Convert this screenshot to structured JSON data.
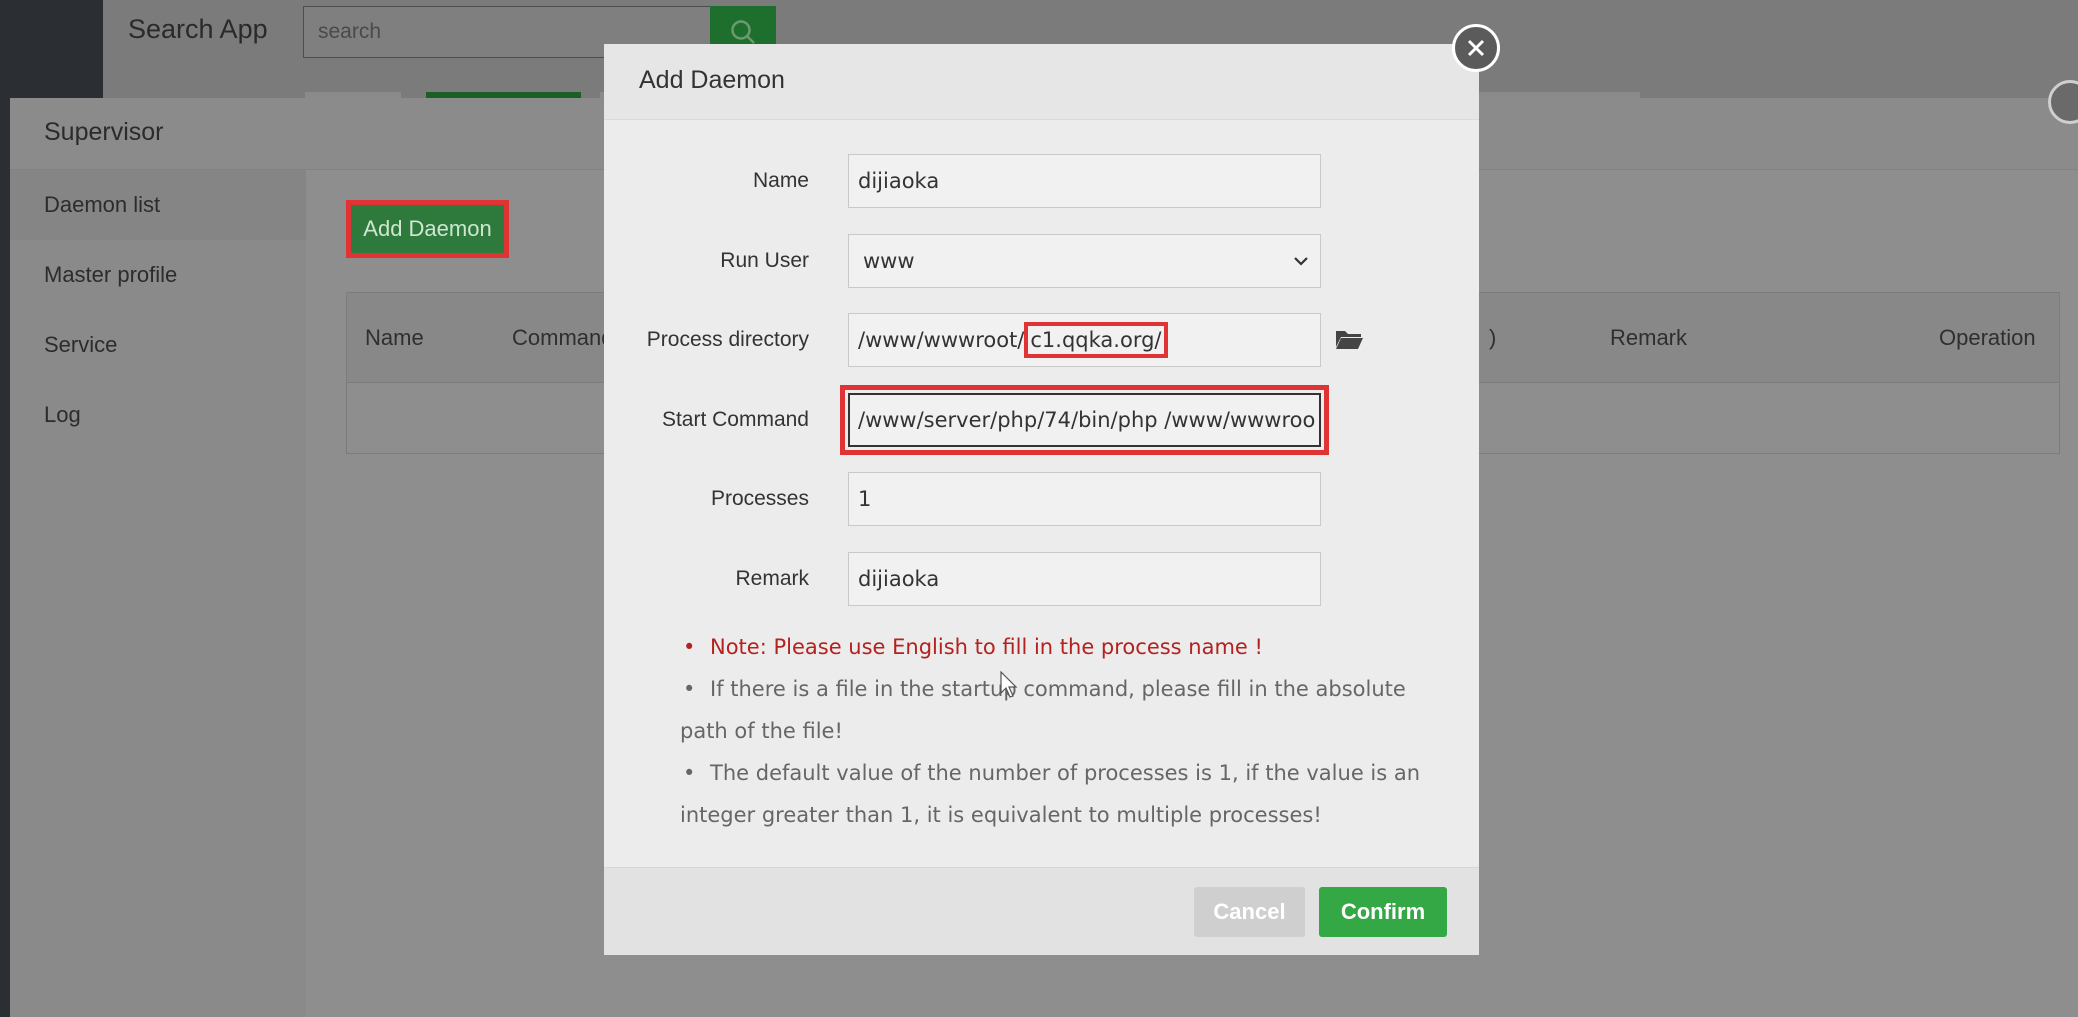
{
  "topbar": {
    "app_title": "Search App",
    "search_placeholder": "search"
  },
  "supervisor": {
    "title": "Supervisor",
    "sidebar": [
      {
        "label": "Daemon list"
      },
      {
        "label": "Master profile"
      },
      {
        "label": "Service"
      },
      {
        "label": "Log"
      }
    ],
    "add_button": "Add Daemon",
    "table_headers": [
      "Name",
      "Command",
      ")",
      "Remark",
      "Operation"
    ]
  },
  "modal": {
    "title": "Add Daemon",
    "fields": {
      "name": {
        "label": "Name",
        "value": "dijiaoka"
      },
      "run_user": {
        "label": "Run User",
        "value": "www"
      },
      "process_directory": {
        "label": "Process directory",
        "value_prefix": "/www/wwwroot/",
        "value_highlight": "c1.qqka.org/"
      },
      "start_command": {
        "label": "Start Command",
        "value": "/www/server/php/74/bin/php /www/wwwroo"
      },
      "processes": {
        "label": "Processes",
        "value": "1"
      },
      "remark": {
        "label": "Remark",
        "value": "dijiaoka"
      }
    },
    "notes": [
      "Note: Please use English to fill in the process name !",
      "If there is a file in the startup command, please fill in the absolute path of the file!",
      "The default value of the number of processes is 1, if the value is an integer greater than 1, it is equivalent to multiple processes!"
    ],
    "cancel_label": "Cancel",
    "confirm_label": "Confirm"
  },
  "colors": {
    "accent_green": "#33a845",
    "highlight_red": "#e03434",
    "warn_text": "#b3221e"
  },
  "icons": [
    "search-icon",
    "close-icon",
    "folder-icon",
    "chevron-down-icon"
  ]
}
